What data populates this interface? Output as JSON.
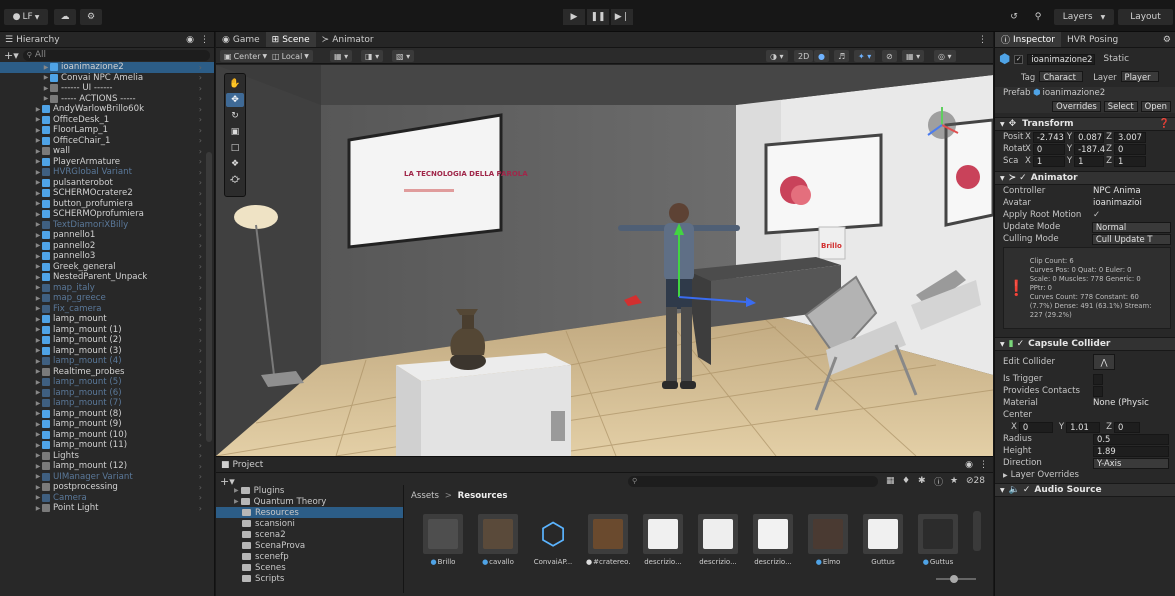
{
  "toolbar": {
    "account_label": "LF",
    "layers_label": "Layers",
    "layout_label": "Layout"
  },
  "hierarchy": {
    "title": "Hierarchy",
    "search_placeholder": "All",
    "items": [
      {
        "label": "ioanimazione2",
        "state": "selected"
      },
      {
        "label": "Convai NPC Amelia"
      },
      {
        "label": "------ UI ------"
      },
      {
        "label": "----- ACTIONS -----"
      },
      {
        "label": "AndyWarlowBrillo60k"
      },
      {
        "label": "OfficeDesk_1"
      },
      {
        "label": "FloorLamp_1"
      },
      {
        "label": "OfficeChair_1"
      },
      {
        "label": "wall"
      },
      {
        "label": "PlayerArmature"
      },
      {
        "label": "HVRGlobal Variant",
        "state": "dim"
      },
      {
        "label": "pulsanterobot"
      },
      {
        "label": "SCHERMOcratere2"
      },
      {
        "label": "button_profumiera"
      },
      {
        "label": "SCHERMOprofumiera"
      },
      {
        "label": "TextDiamoriXBilly",
        "state": "dim"
      },
      {
        "label": "pannello1"
      },
      {
        "label": "pannello2"
      },
      {
        "label": "pannello3"
      },
      {
        "label": "Greek_general"
      },
      {
        "label": "NestedParent_Unpack"
      },
      {
        "label": "map_italy",
        "state": "dim"
      },
      {
        "label": "map_greece",
        "state": "dim"
      },
      {
        "label": "Fix_camera",
        "state": "dim"
      },
      {
        "label": "lamp_mount"
      },
      {
        "label": "lamp_mount (1)"
      },
      {
        "label": "lamp_mount (2)"
      },
      {
        "label": "lamp_mount (3)"
      },
      {
        "label": "lamp_mount (4)",
        "state": "dim"
      },
      {
        "label": "Realtime_probes"
      },
      {
        "label": "lamp_mount (5)",
        "state": "dim"
      },
      {
        "label": "lamp_mount (6)",
        "state": "dim"
      },
      {
        "label": "lamp_mount (7)",
        "state": "dim"
      },
      {
        "label": "lamp_mount (8)"
      },
      {
        "label": "lamp_mount (9)"
      },
      {
        "label": "lamp_mount (10)"
      },
      {
        "label": "lamp_mount (11)"
      },
      {
        "label": "Lights"
      },
      {
        "label": "lamp_mount (12)"
      },
      {
        "label": "UIManager Variant",
        "state": "dim"
      },
      {
        "label": "postprocessing"
      },
      {
        "label": "Camera",
        "state": "dim"
      },
      {
        "label": "Point Light"
      }
    ]
  },
  "scene": {
    "tabs": [
      "Game",
      "Scene",
      "Animator"
    ],
    "pivot_label": "Center",
    "space_label": "Local",
    "mode_2d": "2D",
    "slide_title": "LA TECNOLOGIA DELLA PAROLA",
    "box_label": "Brillo"
  },
  "project": {
    "title": "Project",
    "tree": [
      "Plugins",
      "Quantum Theory",
      "Resources",
      "scansioni",
      "scena2",
      "ScenaProva",
      "scenefp",
      "Scenes",
      "Scripts"
    ],
    "breadcrumb": [
      "Assets",
      "Resources"
    ],
    "hidden_count": "28",
    "assets": [
      "Brillo",
      "cavallo",
      "ConvaiAP...",
      "#cratereo...",
      "descrizio...",
      "descrizio...",
      "descrizio...",
      "Elmo",
      "Guttus",
      "Guttus"
    ]
  },
  "inspector": {
    "tabs": [
      "Inspector",
      "HVR Posing"
    ],
    "object_name": "ioanimazione2",
    "static_label": "Static",
    "tag_label": "Tag",
    "tag_value": "Charact",
    "layer_label": "Layer",
    "layer_value": "Player",
    "prefab_label": "Prefab",
    "prefab_value": "ioanimazione2",
    "overrides_label": "Overrides",
    "select_label": "Select",
    "open_label": "Open",
    "transform": {
      "title": "Transform",
      "position_label": "Posit",
      "position": {
        "x": "-2.743",
        "y": "0.087",
        "z": "3.007"
      },
      "rotation_label": "Rotat",
      "rotation": {
        "x": "0",
        "y": "-187.4",
        "z": "0"
      },
      "scale_label": "Sca",
      "scale": {
        "x": "1",
        "y": "1",
        "z": "1"
      }
    },
    "animator": {
      "title": "Animator",
      "controller_label": "Controller",
      "controller_value": "NPC Anima",
      "avatar_label": "Avatar",
      "avatar_value": "ioanimazioi",
      "root_motion_label": "Apply Root Motion",
      "update_mode_label": "Update Mode",
      "update_mode_value": "Normal",
      "culling_mode_label": "Culling Mode",
      "culling_mode_value": "Cull Update T",
      "info": "Clip Count: 6\nCurves Pos: 0 Quat: 0 Euler: 0\nScale: 0 Muscles: 778 Generic: 0\nPPtr: 0\nCurves Count: 778 Constant: 60\n(7.7%) Dense: 491 (63.1%) Stream:\n227 (29.2%)"
    },
    "capsule": {
      "title": "Capsule Collider",
      "edit_label": "Edit Collider",
      "trigger_label": "Is Trigger",
      "contacts_label": "Provides Contacts",
      "material_label": "Material",
      "material_value": "None (Physic",
      "center_label": "Center",
      "center": {
        "x": "0",
        "y": "1.01",
        "z": "0"
      },
      "radius_label": "Radius",
      "radius_value": "0.5",
      "height_label": "Height",
      "height_value": "1.89",
      "direction_label": "Direction",
      "direction_value": "Y-Axis",
      "layer_overrides_label": "Layer Overrides"
    },
    "audio": {
      "title": "Audio Source"
    }
  }
}
